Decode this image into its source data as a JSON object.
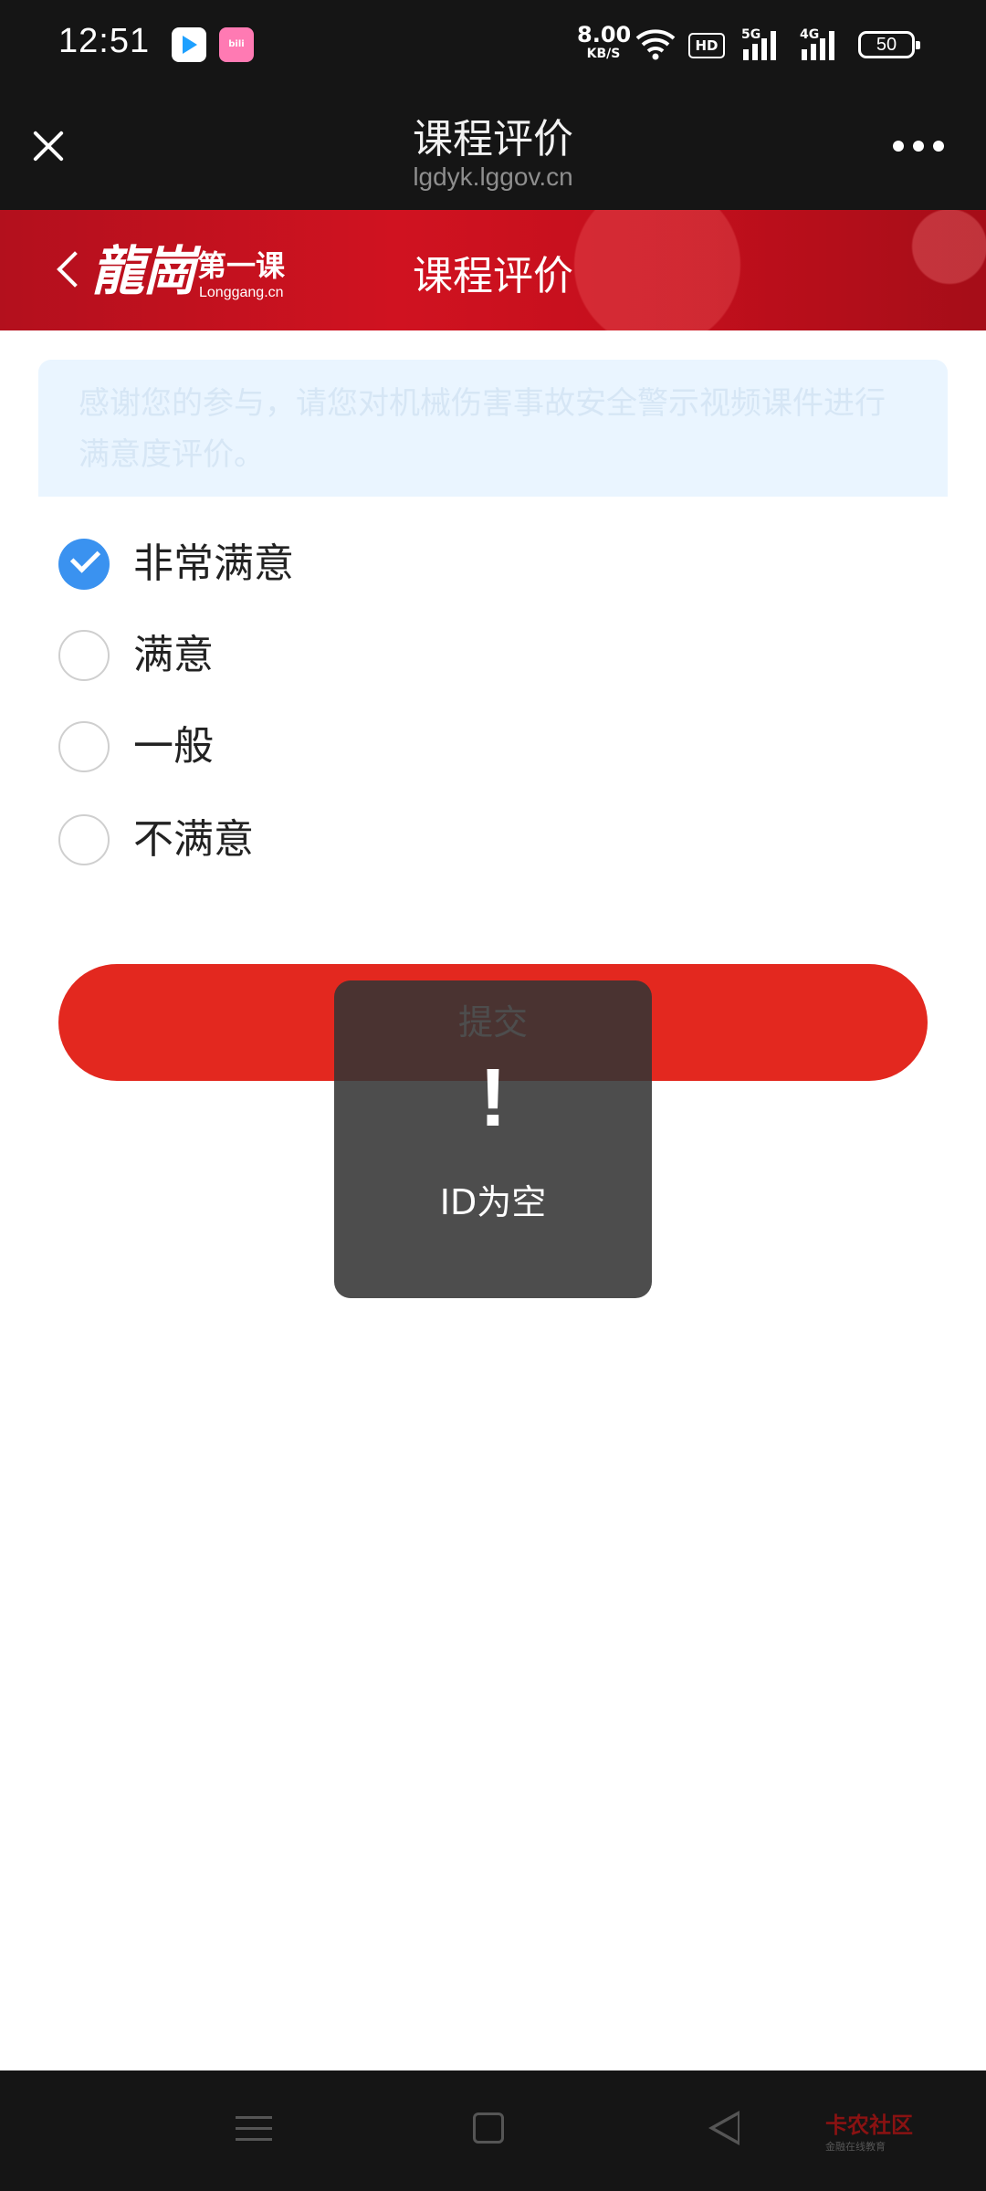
{
  "status_bar": {
    "time": "12:51",
    "net_speed_value": "8.00",
    "net_speed_unit": "KB/S",
    "hd_label": "HD",
    "signal_1_label": "5G",
    "signal_2_label": "4G",
    "battery_level": "50",
    "icons": [
      "video-app-icon",
      "bilibili-app-icon",
      "wifi-icon",
      "signal-icon",
      "battery-icon"
    ]
  },
  "title_bar": {
    "title": "课程评价",
    "url": "lgdyk.lggov.cn"
  },
  "banner": {
    "logo_text": "龍崗",
    "logo_sub": "第一课",
    "logo_site": "Longgang.cn",
    "title": "课程评价"
  },
  "notice": {
    "text": "感谢您的参与，请您对机械伤害事故安全警示视频课件进行满意度评价。"
  },
  "options": [
    {
      "label": "非常满意",
      "checked": true
    },
    {
      "label": "满意",
      "checked": false
    },
    {
      "label": "一般",
      "checked": false
    },
    {
      "label": "不满意",
      "checked": false
    }
  ],
  "submit_label": "提交",
  "toast": {
    "icon": "!",
    "message": "ID为空"
  },
  "watermark": {
    "main": "卡农社区",
    "sub": "金融在线教育"
  },
  "colors": {
    "accent_blue": "#3a92f0",
    "submit_red": "#e3281f",
    "banner_red": "#c8101e",
    "notice_bg": "#eaf5ff"
  }
}
